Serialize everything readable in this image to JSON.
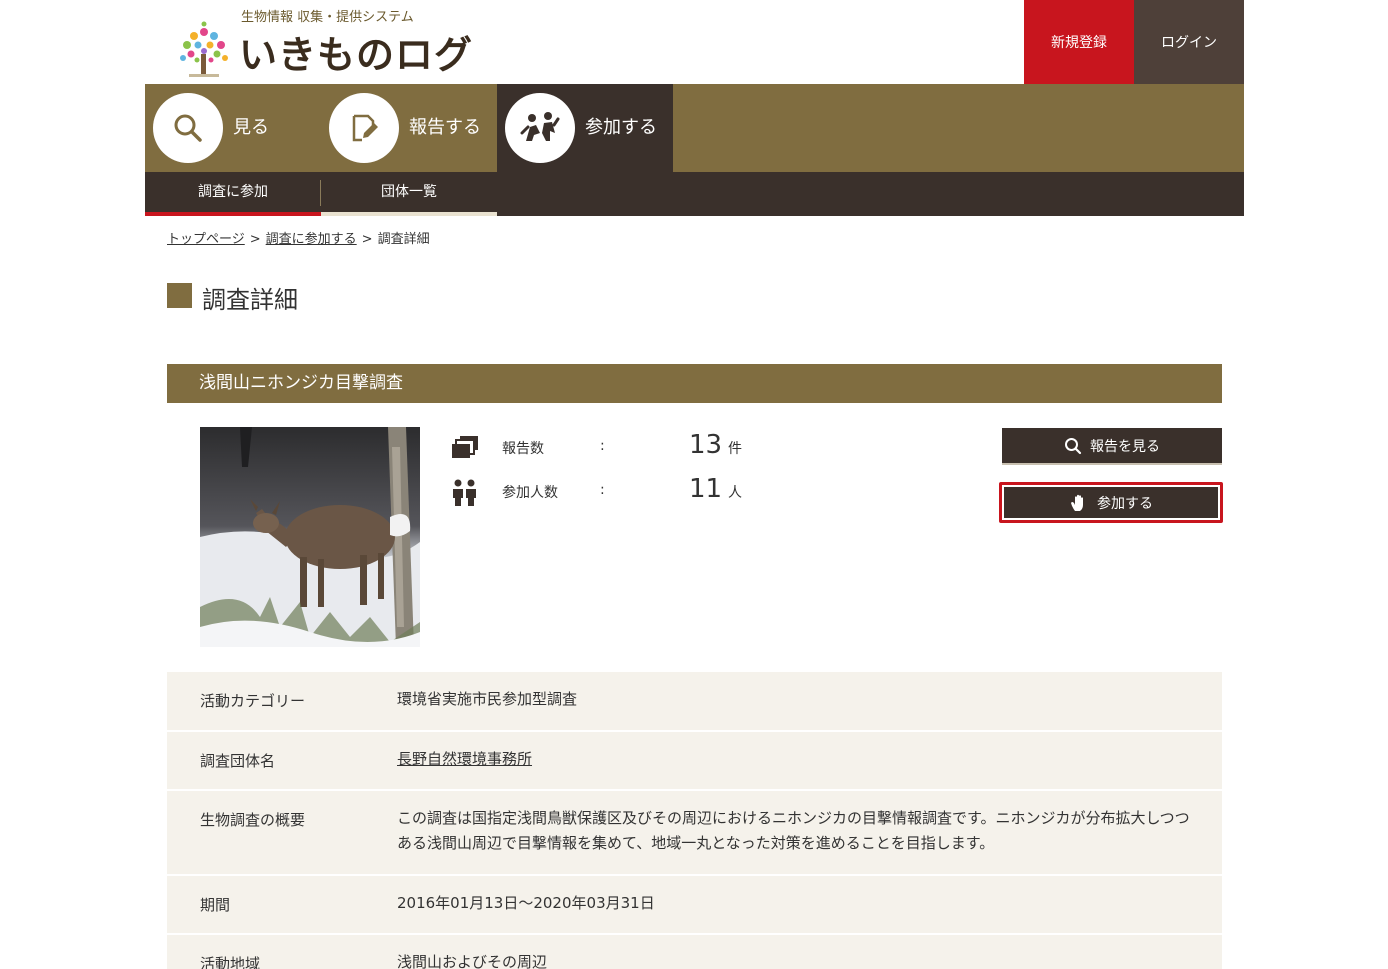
{
  "header": {
    "tagline": "生物情報 収集・提供システム",
    "site_title": "いきものログ",
    "register_label": "新規登録",
    "login_label": "ログイン"
  },
  "nav": {
    "items": [
      {
        "label": "見る",
        "icon": "search-icon"
      },
      {
        "label": "報告する",
        "icon": "edit-icon"
      },
      {
        "label": "参加する",
        "icon": "people-icon",
        "active": true
      }
    ],
    "sub_items": [
      {
        "label": "調査に参加",
        "active": true
      },
      {
        "label": "団体一覧"
      }
    ]
  },
  "breadcrumb": {
    "items": [
      "トップページ",
      "調査に参加する",
      "調査詳細"
    ],
    "separator": ">"
  },
  "page_title": "調査詳細",
  "survey": {
    "title": "浅間山ニホンジカ目撃調査",
    "stats": {
      "reports_label": "報告数",
      "reports_value": "13",
      "reports_unit": "件",
      "participants_label": "参加人数",
      "participants_value": "11",
      "participants_unit": "人",
      "colon": ":"
    },
    "view_reports_label": "報告を見る",
    "join_label": "参加する",
    "details": [
      {
        "label": "活動カテゴリー",
        "value": "環境省実施市民参加型調査"
      },
      {
        "label": "調査団体名",
        "value": "長野自然環境事務所"
      },
      {
        "label": "生物調査の概要",
        "value": "この調査は国指定浅間鳥獣保護区及びその周辺におけるニホンジカの目撃情報調査です。ニホンジカが分布拡大しつつある浅間山周辺で目撃情報を集めて、地域一丸となった対策を進めることを目指します。"
      },
      {
        "label": "期間",
        "value": "2016年01月13日～2020年03月31日"
      },
      {
        "label": "活動地域",
        "value": "浅間山およびその周辺"
      }
    ]
  },
  "colors": {
    "brand_olive": "#806d40",
    "dark_brown": "#3a302b",
    "accent_red": "#c8151e",
    "row_bg": "#f5f2eb"
  }
}
